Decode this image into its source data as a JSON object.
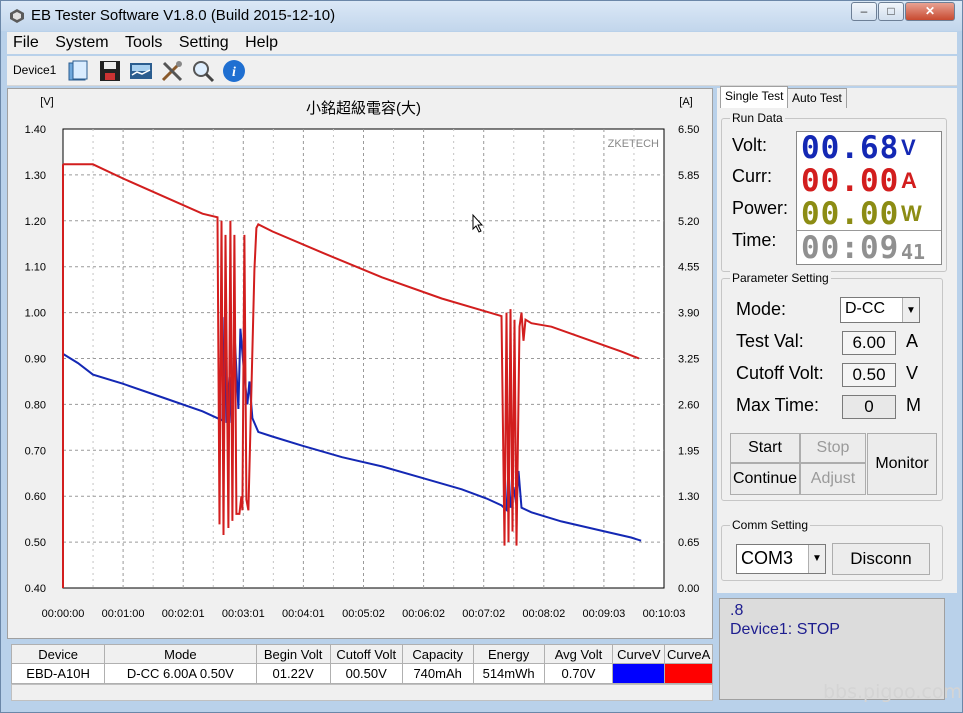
{
  "window": {
    "title": "EB Tester Software V1.8.0 (Build 2015-12-10)",
    "controls": [
      "minimize-button",
      "maximize-button",
      "close-button"
    ]
  },
  "menu": [
    "File",
    "System",
    "Tools",
    "Setting",
    "Help"
  ],
  "toolbar": {
    "device_tab": "Device1",
    "icons": [
      "open-folder-icon",
      "save-icon",
      "chart-icon",
      "tools-icon",
      "zoom-icon",
      "info-icon"
    ]
  },
  "chart_data": {
    "type": "line",
    "title": "小銘超級電容(大)",
    "brand": "ZKETECH",
    "ylabel_left": "[V]",
    "ylabel_right": "[A]",
    "y_left_ticks": [
      "1.40",
      "1.30",
      "1.20",
      "1.10",
      "1.00",
      "0.90",
      "0.80",
      "0.70",
      "0.60",
      "0.50",
      "0.40"
    ],
    "y_right_ticks": [
      "6.50",
      "5.85",
      "5.20",
      "4.55",
      "3.90",
      "3.25",
      "2.60",
      "1.95",
      "1.30",
      "0.65",
      "0.00"
    ],
    "x_ticks": [
      "00:00:00",
      "00:01:00",
      "00:02:01",
      "00:03:01",
      "00:04:01",
      "00:05:02",
      "00:06:02",
      "00:07:02",
      "00:08:02",
      "00:09:03",
      "00:10:03"
    ],
    "ylim_left": [
      0.4,
      1.4
    ],
    "ylim_right": [
      0,
      6.5
    ],
    "xlim_seconds": [
      0,
      603
    ],
    "grid": true,
    "series": [
      {
        "name": "CurveV",
        "color": "#1428b4",
        "axis": "left",
        "points": [
          [
            0,
            0.91
          ],
          [
            15,
            0.89
          ],
          [
            30,
            0.865
          ],
          [
            60,
            0.845
          ],
          [
            100,
            0.815
          ],
          [
            140,
            0.785
          ],
          [
            155,
            0.77
          ],
          [
            160,
            0.765
          ],
          [
            162,
            0.99
          ],
          [
            164,
            0.76
          ],
          [
            167,
            0.86
          ],
          [
            169,
            0.76
          ],
          [
            172,
            0.96
          ],
          [
            176,
            0.79
          ],
          [
            178,
            0.965
          ],
          [
            182,
            0.86
          ],
          [
            185,
            0.8
          ],
          [
            187,
            0.85
          ],
          [
            190,
            0.77
          ],
          [
            196,
            0.74
          ],
          [
            210,
            0.73
          ],
          [
            240,
            0.71
          ],
          [
            280,
            0.685
          ],
          [
            320,
            0.665
          ],
          [
            360,
            0.64
          ],
          [
            400,
            0.615
          ],
          [
            425,
            0.595
          ],
          [
            440,
            0.58
          ],
          [
            445,
            0.57
          ],
          [
            447,
            0.66
          ],
          [
            449,
            0.575
          ],
          [
            452,
            0.62
          ],
          [
            455,
            0.58
          ],
          [
            457,
            0.655
          ],
          [
            460,
            0.575
          ],
          [
            470,
            0.565
          ],
          [
            500,
            0.545
          ],
          [
            540,
            0.525
          ],
          [
            570,
            0.51
          ],
          [
            580,
            0.503
          ]
        ]
      },
      {
        "name": "CurveA",
        "color": "#d21e1e",
        "axis": "right",
        "points": [
          [
            0,
            6.0
          ],
          [
            30,
            6.0
          ],
          [
            60,
            5.8
          ],
          [
            100,
            5.55
          ],
          [
            140,
            5.3
          ],
          [
            155,
            5.25
          ],
          [
            157,
            0.9
          ],
          [
            159,
            5.2
          ],
          [
            161,
            0.75
          ],
          [
            163,
            5.0
          ],
          [
            166,
            0.85
          ],
          [
            168,
            5.2
          ],
          [
            170,
            0.95
          ],
          [
            172,
            5.0
          ],
          [
            174,
            1.05
          ],
          [
            177,
            1.05
          ],
          [
            179,
            1.3
          ],
          [
            180,
            1.1
          ],
          [
            182,
            5.0
          ],
          [
            184,
            1.25
          ],
          [
            186,
            1.1
          ],
          [
            192,
            4.5
          ],
          [
            194,
            5.1
          ],
          [
            196,
            5.15
          ],
          [
            210,
            5.05
          ],
          [
            260,
            4.75
          ],
          [
            320,
            4.4
          ],
          [
            380,
            4.1
          ],
          [
            440,
            3.85
          ],
          [
            443,
            0.6
          ],
          [
            445,
            3.9
          ],
          [
            447,
            0.65
          ],
          [
            449,
            3.95
          ],
          [
            451,
            0.8
          ],
          [
            453,
            3.8
          ],
          [
            455,
            0.6
          ],
          [
            458,
            3.7
          ],
          [
            460,
            3.9
          ],
          [
            462,
            3.5
          ],
          [
            464,
            3.8
          ],
          [
            470,
            3.75
          ],
          [
            490,
            3.7
          ],
          [
            520,
            3.55
          ],
          [
            560,
            3.35
          ],
          [
            578,
            3.25
          ]
        ]
      }
    ]
  },
  "table": {
    "headers": [
      "Device",
      "Mode",
      "Begin Volt",
      "Cutoff Volt",
      "Capacity",
      "Energy",
      "Avg Volt",
      "CurveV",
      "CurveA"
    ],
    "rows": [
      {
        "device": "EBD-A10H",
        "mode": "D-CC  6.00A  0.50V",
        "begin_volt": "01.22V",
        "cutoff_volt": "00.50V",
        "capacity": "740mAh",
        "energy": "514mWh",
        "avg_volt": "0.70V",
        "curve_v_color": "#0000ff",
        "curve_a_color": "#ff0000"
      }
    ]
  },
  "right": {
    "tabs": [
      "Single Test",
      "Auto Test"
    ],
    "run_data": {
      "group_label": "Run Data",
      "volt_label": "Volt:",
      "volt_value": "00.68",
      "volt_unit": "V",
      "curr_label": "Curr:",
      "curr_value": "00.00",
      "curr_unit": "A",
      "power_label": "Power:",
      "power_value": "00.00",
      "power_unit": "W",
      "time_label": "Time:",
      "time_value": "00:09",
      "time_seconds": "41",
      "volt_color": "#1428b4",
      "curr_color": "#d21e1e",
      "power_color": "#8c8c14",
      "time_color": "#909090"
    },
    "params": {
      "group_label": "Parameter Setting",
      "mode_label": "Mode:",
      "mode_value": "D-CC",
      "test_val_label": "Test Val:",
      "test_val_value": "6.00",
      "test_val_unit": "A",
      "cutoff_label": "Cutoff Volt:",
      "cutoff_value": "0.50",
      "cutoff_unit": "V",
      "max_time_label": "Max Time:",
      "max_time_value": "0",
      "max_time_unit": "M",
      "start": "Start",
      "stop": "Stop",
      "monitor": "Monitor",
      "continue": "Continue",
      "adjust": "Adjust"
    },
    "comm": {
      "group_label": "Comm Setting",
      "port": "COM3",
      "disconnect": "Disconn"
    },
    "status": {
      "line1": ".8",
      "line2": "Device1: STOP"
    }
  },
  "watermark": "bbs.pigoo.com"
}
